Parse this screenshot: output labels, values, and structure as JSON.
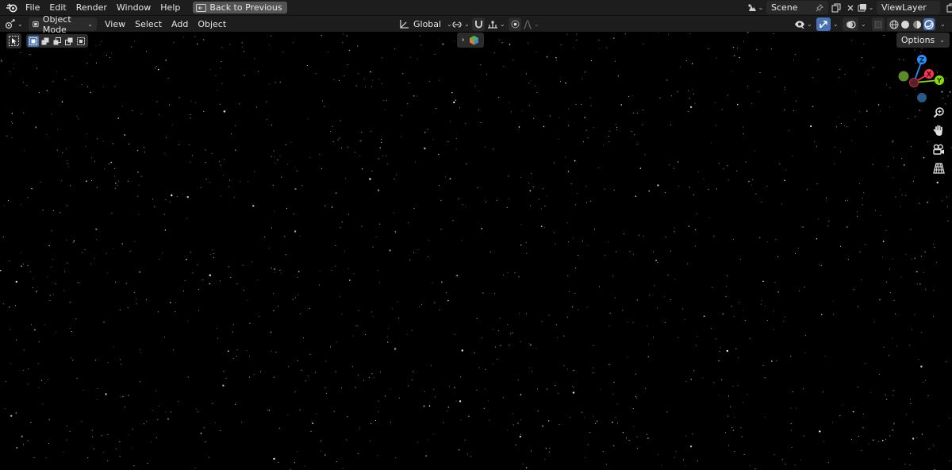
{
  "topbar": {
    "menus": [
      "File",
      "Edit",
      "Render",
      "Window",
      "Help"
    ],
    "back_button": "Back to Previous",
    "scene_name": "Scene",
    "view_layer_name": "ViewLayer"
  },
  "viewport_header": {
    "mode": "Object Mode",
    "menus": [
      "View",
      "Select",
      "Add",
      "Object"
    ],
    "transform_orientation": "Global"
  },
  "viewport": {
    "options_label": "Options",
    "background": "starfield",
    "gizmo_axes": [
      "Z",
      "X",
      "Y"
    ]
  },
  "colors": {
    "bar_bg": "#1d1d1d",
    "widget_bg": "#2b2b2b",
    "accent_blue": "#4772b3",
    "axis_x": "#ff3352",
    "axis_y": "#8bdc00",
    "axis_z": "#2890ff",
    "viewport_bg": "#000000"
  }
}
